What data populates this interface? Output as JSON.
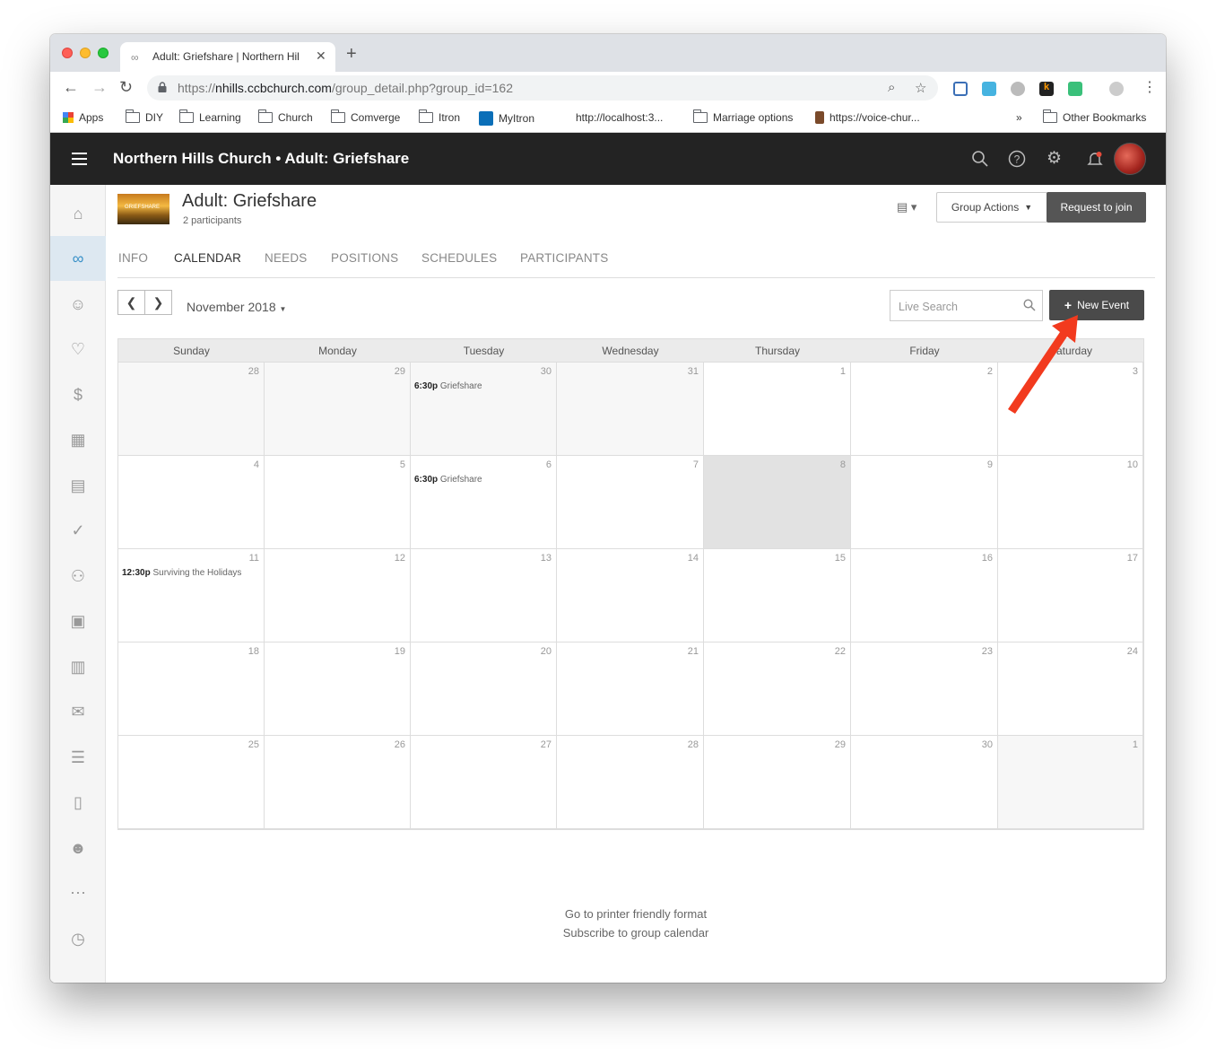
{
  "browser": {
    "tab_title": "Adult: Griefshare | Northern Hil",
    "url_prefix": "https://",
    "url_host": "nhills.ccbchurch.com",
    "url_path": "/group_detail.php?group_id=162",
    "bookmarks": [
      "Apps",
      "DIY",
      "Learning",
      "Church",
      "Comverge",
      "Itron",
      "MyItron",
      "http://localhost:3...",
      "Marriage options",
      "https://voice-chur...",
      "»",
      "Other Bookmarks"
    ]
  },
  "header": {
    "title": "Northern Hills Church • Adult: Griefshare"
  },
  "group": {
    "thumb_text": "GRIEFSHARE",
    "title": "Adult: Griefshare",
    "subtitle": "2 participants",
    "actions_label": "Group Actions",
    "join_label": "Request to join"
  },
  "tabs": [
    "INFO",
    "CALENDAR",
    "NEEDS",
    "POSITIONS",
    "SCHEDULES",
    "PARTICIPANTS"
  ],
  "active_tab": "CALENDAR",
  "toolbar": {
    "month": "November 2018",
    "search_placeholder": "Live Search",
    "new_event_label": "New Event"
  },
  "calendar": {
    "days_of_week": [
      "Sunday",
      "Monday",
      "Tuesday",
      "Wednesday",
      "Thursday",
      "Friday",
      "Saturday"
    ],
    "weeks": [
      [
        {
          "d": "28",
          "dim": true
        },
        {
          "d": "29",
          "dim": true
        },
        {
          "d": "30",
          "dim": true,
          "time": "6:30p",
          "name": "Griefshare"
        },
        {
          "d": "31",
          "dim": true
        },
        {
          "d": "1"
        },
        {
          "d": "2"
        },
        {
          "d": "3"
        }
      ],
      [
        {
          "d": "4"
        },
        {
          "d": "5"
        },
        {
          "d": "6",
          "time": "6:30p",
          "name": "Griefshare"
        },
        {
          "d": "7"
        },
        {
          "d": "8",
          "today": true
        },
        {
          "d": "9"
        },
        {
          "d": "10"
        }
      ],
      [
        {
          "d": "11",
          "time": "12:30p",
          "name": "Surviving the Holidays"
        },
        {
          "d": "12"
        },
        {
          "d": "13"
        },
        {
          "d": "14"
        },
        {
          "d": "15"
        },
        {
          "d": "16"
        },
        {
          "d": "17"
        }
      ],
      [
        {
          "d": "18"
        },
        {
          "d": "19"
        },
        {
          "d": "20"
        },
        {
          "d": "21"
        },
        {
          "d": "22"
        },
        {
          "d": "23"
        },
        {
          "d": "24"
        }
      ],
      [
        {
          "d": "25"
        },
        {
          "d": "26"
        },
        {
          "d": "27"
        },
        {
          "d": "28"
        },
        {
          "d": "29"
        },
        {
          "d": "30"
        },
        {
          "d": "1",
          "dim": true
        }
      ]
    ]
  },
  "footer": {
    "printer_link": "Go to printer friendly format",
    "subscribe_link": "Subscribe to group calendar"
  },
  "colors": {
    "header_bg": "#232323",
    "annotation_arrow": "#f23a1e",
    "active_sidebar": "#3a91c8"
  }
}
